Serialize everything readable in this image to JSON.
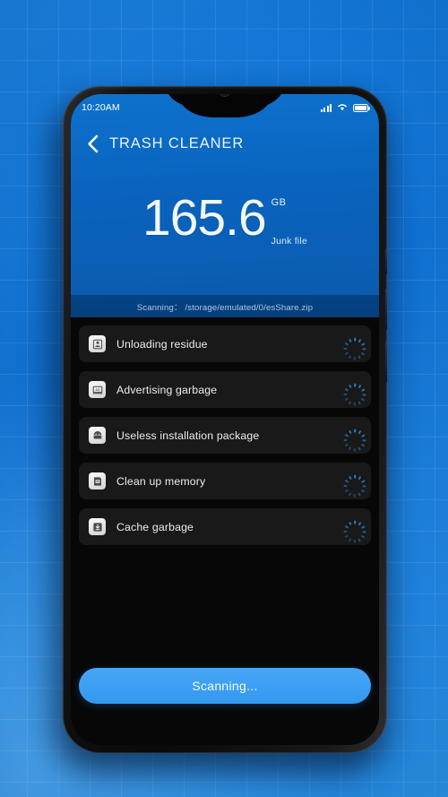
{
  "status_bar": {
    "time": "10:20AM",
    "icons": [
      "signal-icon",
      "wifi-icon",
      "battery-icon"
    ]
  },
  "app_bar": {
    "back_icon": "chevron-left-icon",
    "title": "TRASH CLEANER"
  },
  "summary": {
    "value": "165.6",
    "unit": "GB",
    "caption": "Junk file"
  },
  "scan_status": {
    "label": "Scanning：",
    "path": "/storage/emulated/0/esShare.zip",
    "full_text": "Scanning： /storage/emulated/0/esShare.zip"
  },
  "tasks": [
    {
      "label": "Unloading residue",
      "icon": "uninstall-residue-icon",
      "state_icon": "loading-spinner-icon"
    },
    {
      "label": "Advertising garbage",
      "icon": "ad-garbage-icon",
      "state_icon": "loading-spinner-icon"
    },
    {
      "label": "Useless installation package",
      "icon": "android-package-icon",
      "state_icon": "loading-spinner-icon"
    },
    {
      "label": "Clean up memory",
      "icon": "memory-chip-icon",
      "state_icon": "loading-spinner-icon"
    },
    {
      "label": "Cache garbage",
      "icon": "cache-download-icon",
      "state_icon": "loading-spinner-icon"
    }
  ],
  "action_button": {
    "label": "Scanning..."
  },
  "colors": {
    "header_blue": "#0a63bd",
    "accent_blue": "#3aa0f5",
    "scan_strip": "#053c78",
    "list_row": "#191919",
    "screen_bg": "#070707",
    "background_blue": "#1a7fdc",
    "spinner_blue": "#2f7fc4"
  }
}
